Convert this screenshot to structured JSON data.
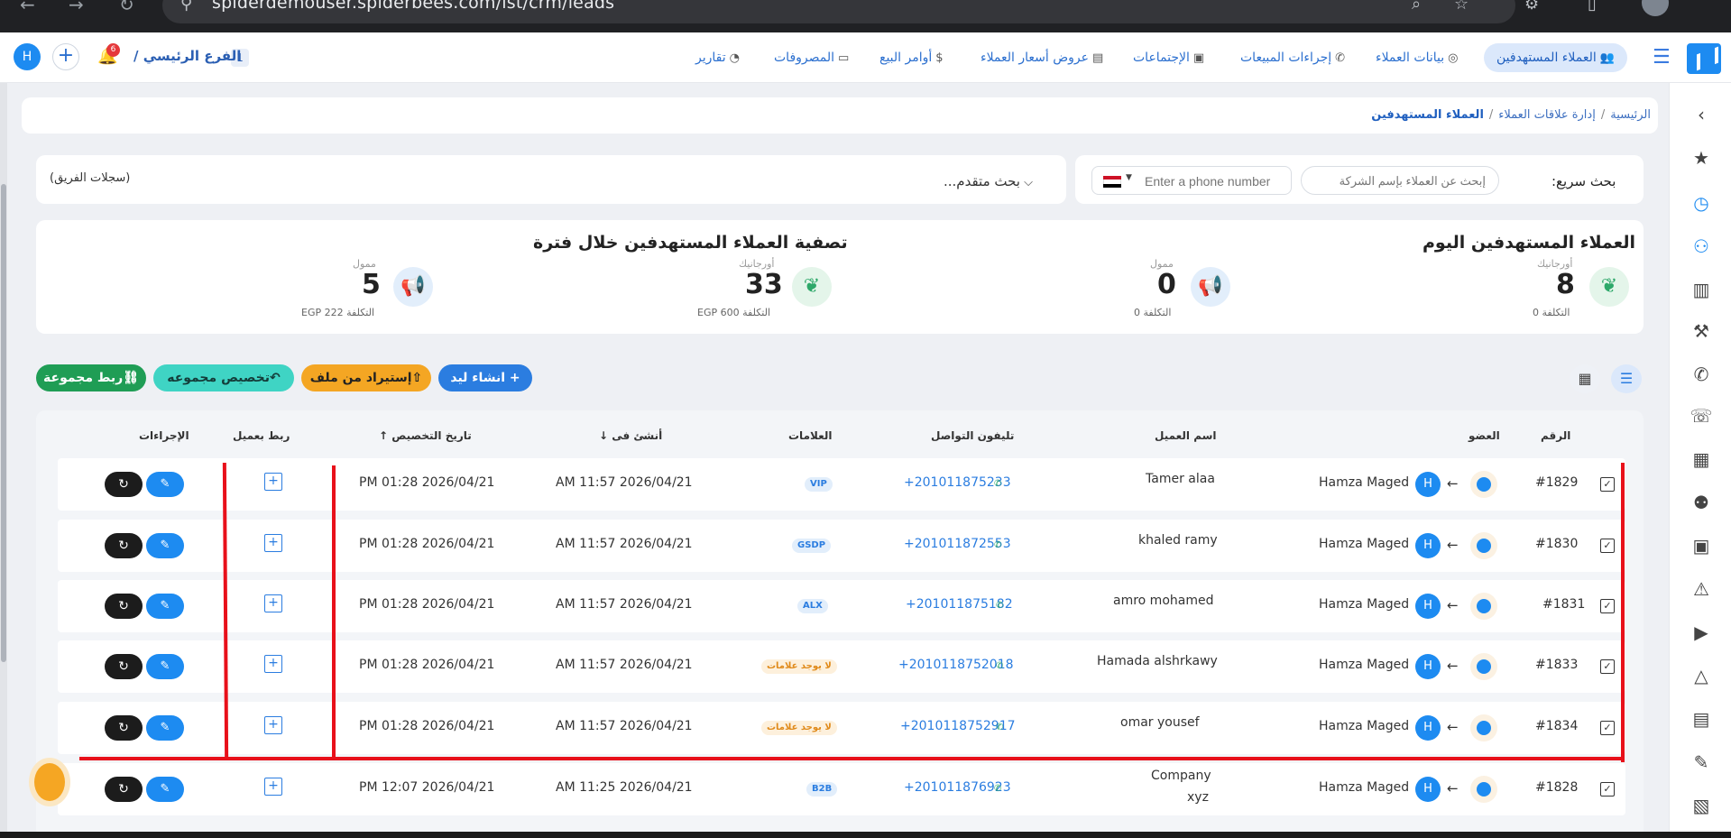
{
  "browser": {
    "url": "spiderdemouser.spiderbees.com/ist/crm/leads"
  },
  "topnav": {
    "items": [
      {
        "label": "العملاء المستهدفين",
        "active": true
      },
      {
        "label": "بيانات العملاء"
      },
      {
        "label": "إجراءات المبيعات"
      },
      {
        "label": "الإجتماعات"
      },
      {
        "label": "عروض أسعار العملاء"
      },
      {
        "label": "أوامر البيع"
      },
      {
        "label": "المصروفات"
      },
      {
        "label": "تقارير"
      }
    ],
    "branch_label": "الفرع الرئيسي /",
    "branch_count": "1",
    "notification_count": "6",
    "user_initial": "H"
  },
  "breadcrumb": {
    "home": "الرئيسية",
    "section": "إدارة علاقات العملاء",
    "current": "العملاء المستهدفين"
  },
  "search": {
    "quick_label": "بحث سريع:",
    "company_placeholder": "إبحث عن العملاء بإسم الشركة",
    "phone_placeholder": "Enter a phone number",
    "advanced_label": "بحث متقدم...",
    "team_records": "(سجلات الفريق)"
  },
  "stats": {
    "today_title": "العملاء المستهدفين اليوم",
    "period_title": "تصفية العملاء المستهدفين خلال فترة",
    "today_organic": {
      "label": "أورجانيك",
      "value": "8",
      "cost": "التكلفة 0"
    },
    "today_paid": {
      "label": "ممول",
      "value": "0",
      "cost": "التكلفة 0"
    },
    "period_organic": {
      "label": "أورجانيك",
      "value": "33",
      "cost": "التكلفة EGP 600"
    },
    "period_paid": {
      "label": "ممول",
      "value": "5",
      "cost": "التكلفة EGP 222"
    }
  },
  "actions": {
    "create_lead": "+ انشاء ليد",
    "import_file": "⇧إستيراد من ملف",
    "assign_group": "↶تخصيص مجموعه",
    "link_group": "⛓ربط مجموعة"
  },
  "table": {
    "headers": {
      "number": "الرقم",
      "member": "العضو",
      "client_name": "اسم العميل",
      "phone": "تليفون التواصل",
      "tags": "العلامات",
      "created_at": "أنشئ فى",
      "assigned_at": "تاريخ التخصيص",
      "link_client": "ربط بعميل",
      "actions": "الإجراءات"
    },
    "rows": [
      {
        "id": "#1829",
        "member": "Hamza Maged",
        "initial": "H",
        "name": "Tamer alaa",
        "name2": "",
        "phone": "+201011875233",
        "tag": "VIP",
        "tag_style": "blue",
        "created": "AM 11:57 2026/04/21",
        "assigned": "PM 01:28 2026/04/21"
      },
      {
        "id": "#1830",
        "member": "Hamza Maged",
        "initial": "H",
        "name": "khaled ramy",
        "name2": "",
        "phone": "+201011872553",
        "tag": "GSDP",
        "tag_style": "blue",
        "created": "AM 11:57 2026/04/21",
        "assigned": "PM 01:28 2026/04/21"
      },
      {
        "id": "#1831",
        "member": "Hamza Maged",
        "initial": "H",
        "name": "amro mohamed",
        "name2": "",
        "phone": "+201011875182",
        "tag": "ALX",
        "tag_style": "blue",
        "created": "AM 11:57 2026/04/21",
        "assigned": "PM 01:28 2026/04/21"
      },
      {
        "id": "#1833",
        "member": "Hamza Maged",
        "initial": "H",
        "name": "Hamada alshrkawy",
        "name2": "",
        "phone": "+2010118752018",
        "tag": "لا يوجد علامات",
        "tag_style": "orange",
        "created": "AM 11:57 2026/04/21",
        "assigned": "PM 01:28 2026/04/21"
      },
      {
        "id": "#1834",
        "member": "Hamza Maged",
        "initial": "H",
        "name": "omar yousef",
        "name2": "",
        "phone": "+2010118752917",
        "tag": "لا يوجد علامات",
        "tag_style": "orange",
        "created": "AM 11:57 2026/04/21",
        "assigned": "PM 01:28 2026/04/21"
      },
      {
        "id": "#1828",
        "member": "Hamza Maged",
        "initial": "H",
        "name": "Company",
        "name2": "xyz",
        "phone": "+201011876923",
        "tag": "B2B",
        "tag_style": "blue",
        "created": "AM 11:25 2026/04/21",
        "assigned": "PM 12:07 2026/04/21"
      }
    ]
  }
}
